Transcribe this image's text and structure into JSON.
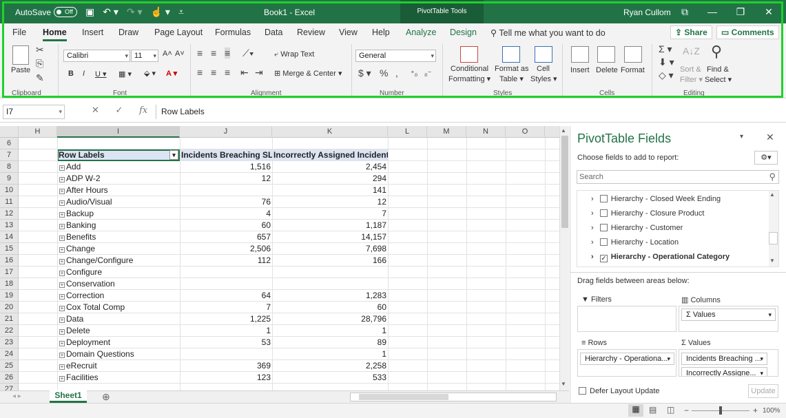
{
  "titlebar": {
    "autosave": "AutoSave",
    "toggle": "Off",
    "book": "Book1  -  Excel",
    "context": "PivotTable Tools",
    "user": "Ryan Cullom"
  },
  "tabs": [
    "File",
    "Home",
    "Insert",
    "Draw",
    "Page Layout",
    "Formulas",
    "Data",
    "Review",
    "View",
    "Help",
    "Analyze",
    "Design"
  ],
  "tell_me": "Tell me what you want to do",
  "share": "Share",
  "comments": "Comments",
  "ribbon": {
    "paste": "Paste",
    "clipboard": "Clipboard",
    "font_name": "Calibri",
    "font_size": "11",
    "font": "Font",
    "wrap_text": "Wrap Text",
    "merge_center": "Merge & Center",
    "alignment": "Alignment",
    "number_format": "General",
    "number": "Number",
    "conditional": "Conditional",
    "formatting": "Formatting",
    "format_as": "Format as",
    "table": "Table",
    "cell": "Cell",
    "styles_btn": "Styles",
    "styles": "Styles",
    "insert": "Insert",
    "delete": "Delete",
    "format": "Format",
    "cells": "Cells",
    "sort": "Sort &",
    "filter": "Filter",
    "find": "Find &",
    "select": "Select",
    "editing": "Editing"
  },
  "namebox": "I7",
  "fx": "fx",
  "formula": "Row Labels",
  "columns": [
    "H",
    "I",
    "J",
    "K",
    "L",
    "M",
    "N",
    "O"
  ],
  "header_row": {
    "row": "7",
    "label": "Row Labels",
    "c1": "Incidents Breaching SLA",
    "c2": "Incorrectly Assigned Incidents"
  },
  "rows": [
    {
      "n": "8",
      "label": "Add",
      "a": "1,516",
      "b": "2,454"
    },
    {
      "n": "9",
      "label": "ADP W-2",
      "a": "12",
      "b": "294"
    },
    {
      "n": "10",
      "label": "After Hours",
      "a": "",
      "b": "141"
    },
    {
      "n": "11",
      "label": "Audio/Visual",
      "a": "76",
      "b": "12"
    },
    {
      "n": "12",
      "label": "Backup",
      "a": "4",
      "b": "7"
    },
    {
      "n": "13",
      "label": "Banking",
      "a": "60",
      "b": "1,187"
    },
    {
      "n": "14",
      "label": "Benefits",
      "a": "657",
      "b": "14,157"
    },
    {
      "n": "15",
      "label": "Change",
      "a": "2,506",
      "b": "7,698"
    },
    {
      "n": "16",
      "label": "Change/Configure",
      "a": "112",
      "b": "166"
    },
    {
      "n": "17",
      "label": "Configure",
      "a": "",
      "b": ""
    },
    {
      "n": "18",
      "label": "Conservation",
      "a": "",
      "b": ""
    },
    {
      "n": "19",
      "label": "Correction",
      "a": "64",
      "b": "1,283"
    },
    {
      "n": "20",
      "label": "Cox Total Comp",
      "a": "7",
      "b": "60"
    },
    {
      "n": "21",
      "label": "Data",
      "a": "1,225",
      "b": "28,796"
    },
    {
      "n": "22",
      "label": "Delete",
      "a": "1",
      "b": "1"
    },
    {
      "n": "23",
      "label": "Deployment",
      "a": "53",
      "b": "89"
    },
    {
      "n": "24",
      "label": "Domain Questions",
      "a": "",
      "b": "1"
    },
    {
      "n": "25",
      "label": "eRecruit",
      "a": "369",
      "b": "2,258"
    },
    {
      "n": "26",
      "label": "Facilities",
      "a": "123",
      "b": "533"
    }
  ],
  "row6": "6",
  "sheet": "Sheet1",
  "pivot": {
    "title": "PivotTable Fields",
    "choose": "Choose fields to add to report:",
    "search": "Search",
    "fields": [
      {
        "label": "Hierarchy - Closed Week Ending",
        "checked": false
      },
      {
        "label": "Hierarchy - Closure Product",
        "checked": false
      },
      {
        "label": "Hierarchy - Customer",
        "checked": false
      },
      {
        "label": "Hierarchy - Location",
        "checked": false
      },
      {
        "label": "Hierarchy - Operational Category",
        "checked": true
      }
    ],
    "drag": "Drag fields between areas below:",
    "filters": "Filters",
    "columns": "Columns",
    "rows": "Rows",
    "values": "Values",
    "col_pill": "Σ Values",
    "row_pill": "Hierarchy - Operationa...",
    "val_pill1": "Incidents Breaching ...",
    "val_pill2": "Incorrectly Assigne...",
    "defer": "Defer Layout Update",
    "update": "Update"
  },
  "zoom": "100%"
}
